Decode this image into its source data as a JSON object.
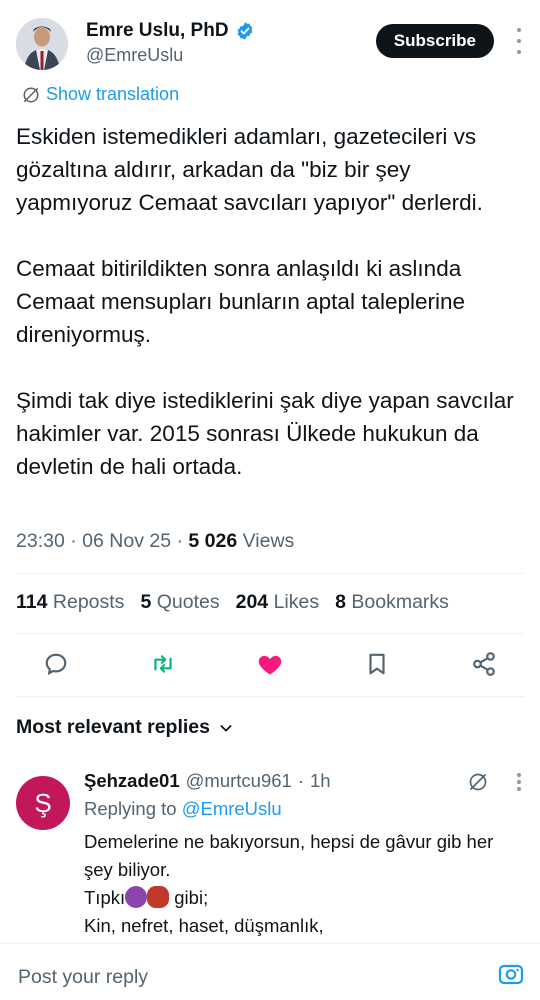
{
  "author": {
    "display_name": "Emre Uslu, PhD",
    "handle": "@EmreUslu",
    "verified": true
  },
  "subscribe_label": "Subscribe",
  "show_translation": "Show translation",
  "tweet": {
    "paragraphs": [
      "Eskiden istemedikleri adamları, gazetecileri vs gözaltına aldırır, arkadan da \"biz bir şey yapmıyoruz Cemaat savcıları yapıyor\" derlerdi.",
      "Cemaat bitirildikten sonra anlaşıldı ki aslında Cemaat mensupları bunların aptal taleplerine direniyormuş.",
      "Şimdi tak diye istediklerini şak diye yapan savcılar hakimler var. 2015 sonrası Ülkede hukukun da devletin de hali ortada."
    ],
    "time": "23:30",
    "date": "06 Nov 25",
    "views_count": "5 026",
    "views_label": "Views"
  },
  "stats": {
    "reposts_count": "114",
    "reposts_label": "Reposts",
    "quotes_count": "5",
    "quotes_label": "Quotes",
    "likes_count": "204",
    "likes_label": "Likes",
    "bookmarks_count": "8",
    "bookmarks_label": "Bookmarks"
  },
  "actions": {
    "reply_icon": "speech-bubble-icon",
    "repost_icon": "repost-arrows-icon",
    "like_icon": "heart-icon",
    "bookmark_icon": "bookmark-icon",
    "share_icon": "share-nodes-icon",
    "repost_color": "#00ba7c",
    "like_color": "#f91880"
  },
  "replies_sort": "Most relevant replies",
  "reply": {
    "avatar_letter": "Ş",
    "avatar_color": "#c2185b",
    "name": "Şehzade01",
    "handle": "@murtcu961",
    "age": "1h",
    "replying_prefix": "Replying to",
    "replying_to": "@EmreUslu",
    "line1": "Demelerine ne bakıyorsun, hepsi de gâvur gib her şey biliyor.",
    "line2_before": "Tıpkı",
    "line2_after": "gibi;",
    "line3": "Kin, nefret, haset, düşmanlık,"
  },
  "composer_placeholder": "Post your reply",
  "accent_color": "#1d9bf0"
}
